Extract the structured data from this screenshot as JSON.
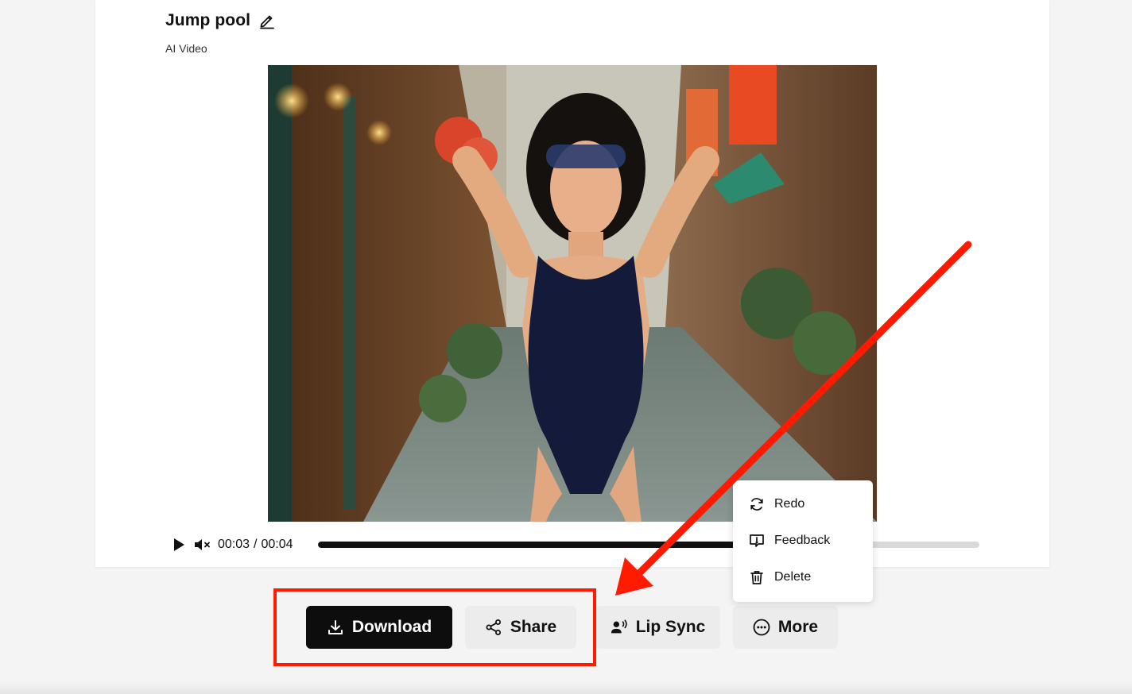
{
  "header": {
    "title": "Jump pool",
    "subtitle": "AI Video"
  },
  "player": {
    "current_time": "00:03",
    "separator": "/",
    "duration": "00:04",
    "progress_fraction": 0.75,
    "state": "paused",
    "muted": true
  },
  "actions": {
    "download_label": "Download",
    "share_label": "Share",
    "lipsync_label": "Lip Sync",
    "more_label": "More"
  },
  "more_menu": {
    "items": [
      {
        "label": "Redo",
        "icon": "redo-icon"
      },
      {
        "label": "Feedback",
        "icon": "feedback-icon"
      },
      {
        "label": "Delete",
        "icon": "trash-icon"
      }
    ]
  },
  "annotation": {
    "color": "#ff1a00"
  },
  "colors": {
    "primary_button": "#0d0d0d",
    "secondary_button": "#ececec",
    "progress_fill": "#111111",
    "progress_track": "#d9d9d9"
  }
}
